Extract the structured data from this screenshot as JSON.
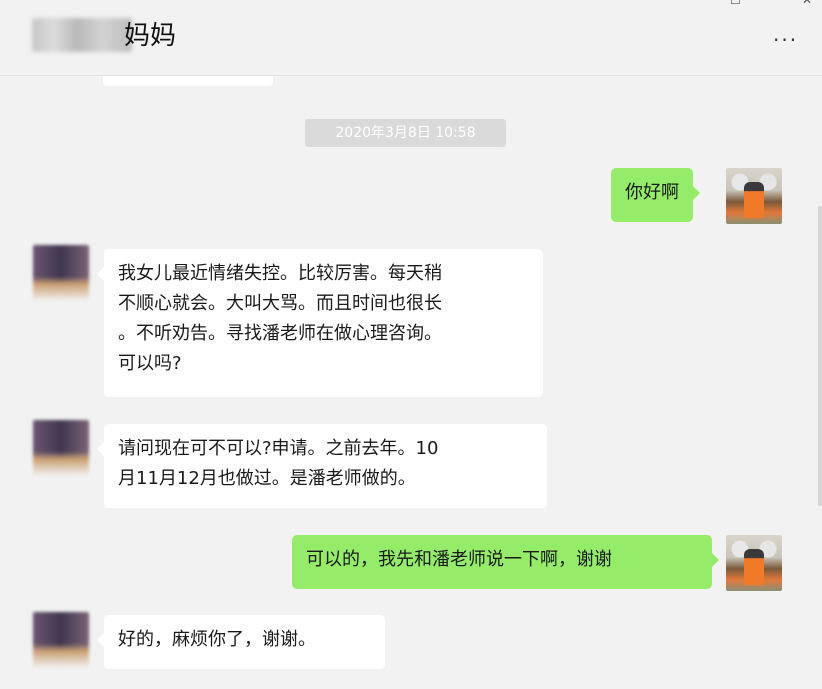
{
  "header": {
    "title": "妈妈",
    "more_label": "···",
    "window_controls": [
      "一",
      "☐",
      "✕"
    ]
  },
  "timestamp": "2020年3月8日 10:58",
  "messages": [
    {
      "side": "right",
      "lines": [
        "你好啊"
      ]
    },
    {
      "side": "left",
      "lines": [
        "我女儿最近情绪失控。比较厉害。每天稍",
        "不顺心就会。大叫大骂。而且时间也很长",
        "。不听劝告。寻找潘老师在做心理咨询。",
        "可以吗?"
      ]
    },
    {
      "side": "left",
      "lines": [
        "请问现在可不可以?申请。之前去年。10",
        "月11月12月也做过。是潘老师做的。"
      ]
    },
    {
      "side": "right",
      "lines": [
        "可以的，我先和潘老师说一下啊，谢谢"
      ]
    },
    {
      "side": "left",
      "lines": [
        "好的，麻烦你了，谢谢。"
      ]
    }
  ],
  "colors": {
    "background": "#f2f2f2",
    "sent_bubble": "#95ec69",
    "received_bubble": "#ffffff",
    "timestamp_bg": "#dadada"
  }
}
